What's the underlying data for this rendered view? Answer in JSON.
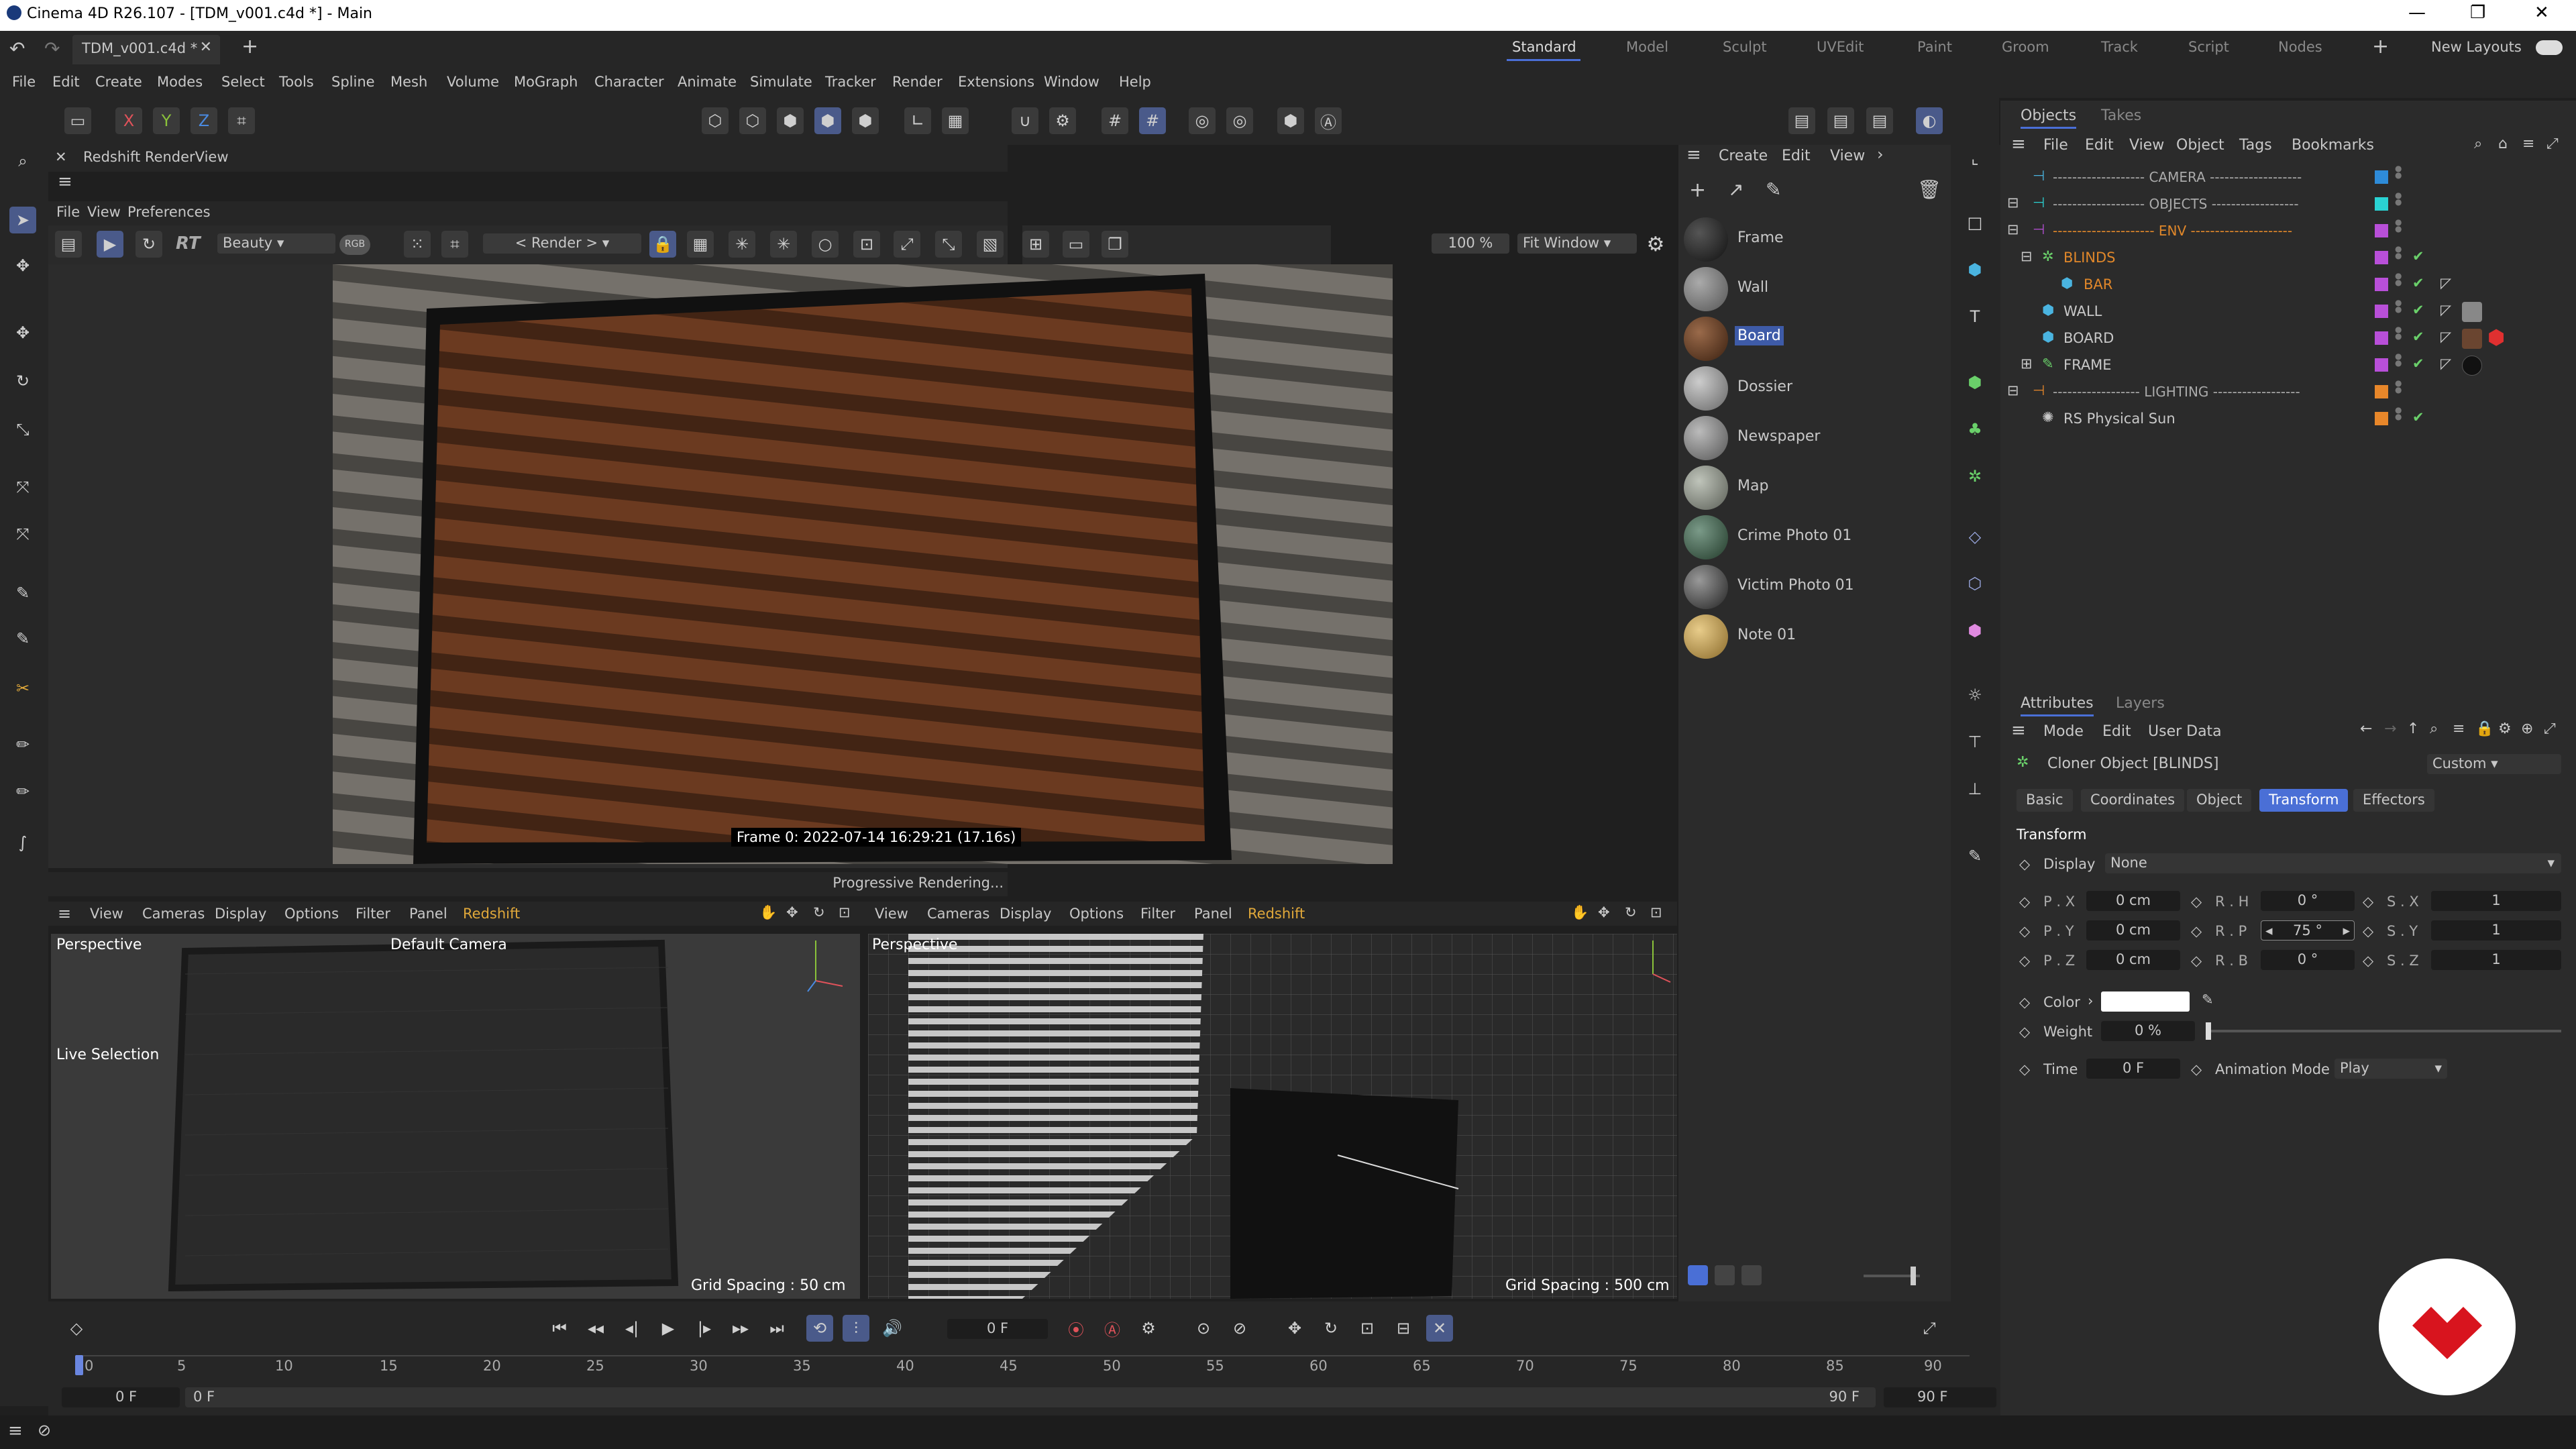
{
  "title_bar": {
    "title": "Cinema 4D R26.107 - [TDM_v001.c4d *] - Main"
  },
  "doc_tab": {
    "label": "TDM_v001.c4d *"
  },
  "layouts": {
    "items": [
      "Standard",
      "Model",
      "Sculpt",
      "UVEdit",
      "Paint",
      "Groom",
      "Track",
      "Script",
      "Nodes"
    ],
    "active": "Standard",
    "new_layouts": "New Layouts"
  },
  "menu": [
    "File",
    "Edit",
    "Create",
    "Modes",
    "Select",
    "Tools",
    "Spline",
    "Mesh",
    "Volume",
    "MoGraph",
    "Character",
    "Animate",
    "Simulate",
    "Tracker",
    "Render",
    "Extensions",
    "Window",
    "Help"
  ],
  "axes": {
    "x": "X",
    "y": "Y",
    "z": "Z"
  },
  "renderview": {
    "title": "Redshift RenderView",
    "menu": [
      "File",
      "View",
      "Preferences"
    ],
    "rt": "RT",
    "aov": "Beauty",
    "rgb": "RGB",
    "render_sel": "< Render >",
    "zoom": "100 %",
    "fit": "Fit Window",
    "frame_info": "Frame  0:  2022-07-14  16:29:21  (17.16s)",
    "status": "Progressive Rendering..."
  },
  "viewport_left": {
    "menu": [
      "View",
      "Cameras",
      "Display",
      "Options",
      "Filter",
      "Panel",
      "Redshift"
    ],
    "label": "Perspective",
    "camera": "Default Camera",
    "tool": "Live Selection",
    "grid": "Grid Spacing : 50 cm"
  },
  "viewport_right": {
    "menu": [
      "View",
      "Cameras",
      "Display",
      "Options",
      "Filter",
      "Panel",
      "Redshift"
    ],
    "label": "Perspective",
    "grid": "Grid Spacing : 500 cm"
  },
  "materials": {
    "menu": [
      "Create",
      "Edit",
      "View"
    ],
    "items": [
      {
        "name": "Frame",
        "color": "#1e1e1e"
      },
      {
        "name": "Wall",
        "color": "#7a7a7a"
      },
      {
        "name": "Board",
        "color": "#6a4530"
      },
      {
        "name": "Dossier",
        "color": "#9a9a9a"
      },
      {
        "name": "Newspaper",
        "color": "#8e8e8e"
      },
      {
        "name": "Map",
        "color": "#8f948c"
      },
      {
        "name": "Crime Photo 01",
        "color": "#4a6a58"
      },
      {
        "name": "Victim Photo 01",
        "color": "#555555"
      },
      {
        "name": "Note 01",
        "color": "#c9a45a"
      }
    ],
    "selected": "Board"
  },
  "objects": {
    "tabs": [
      "Objects",
      "Takes"
    ],
    "menu": [
      "File",
      "Edit",
      "View",
      "Object",
      "Tags",
      "Bookmarks"
    ],
    "rows": [
      {
        "name": "------------------- CAMERA -------------------",
        "color": "#2e8bd8",
        "indent": 0,
        "check": false
      },
      {
        "name": "------------------- OBJECTS ------------------",
        "color": "#2ad3d3",
        "indent": 0,
        "check": false
      },
      {
        "name": "--------------------- ENV ---------------------",
        "color": "#b84fd8",
        "indent": 0,
        "check": false,
        "orange": true
      },
      {
        "name": "BLINDS",
        "color": "#b84fd8",
        "indent": 1,
        "check": true,
        "orange": true
      },
      {
        "name": "BAR",
        "color": "#b84fd8",
        "indent": 2,
        "check": true,
        "orange": true
      },
      {
        "name": "WALL",
        "color": "#b84fd8",
        "indent": 1,
        "check": true
      },
      {
        "name": "BOARD",
        "color": "#b84fd8",
        "indent": 1,
        "check": true
      },
      {
        "name": "FRAME",
        "color": "#b84fd8",
        "indent": 1,
        "check": true
      },
      {
        "name": "------------------ LIGHTING ------------------",
        "color": "#e8872a",
        "indent": 0,
        "check": false
      },
      {
        "name": "RS Physical Sun",
        "color": "#e8872a",
        "indent": 1,
        "check": true
      }
    ]
  },
  "attributes": {
    "tabs": [
      "Attributes",
      "Layers"
    ],
    "menu": [
      "Mode",
      "Edit",
      "User Data"
    ],
    "object": "Cloner Object [BLINDS]",
    "preset": "Custom",
    "subtabs": [
      "Basic",
      "Coordinates",
      "Object",
      "Transform",
      "Effectors"
    ],
    "active_tab": "Transform",
    "section": "Transform",
    "display_label": "Display",
    "display_value": "None",
    "px": "0 cm",
    "py": "0 cm",
    "pz": "0 cm",
    "rh": "0 °",
    "rp": "75 °",
    "rb": "0 °",
    "sx": "1",
    "sy": "1",
    "sz": "1",
    "color_label": "Color",
    "weight_label": "Weight",
    "weight": "0 %",
    "time_label": "Time",
    "time": "0 F",
    "anim_label": "Animation Mode",
    "anim": "Play",
    "labels": {
      "px": "P . X",
      "py": "P . Y",
      "pz": "P . Z",
      "rh": "R . H",
      "rp": "R . P",
      "rb": "R . B",
      "sx": "S . X",
      "sy": "S . Y",
      "sz": "S . Z"
    }
  },
  "timeline": {
    "current": "0 F",
    "ticks": [
      "0",
      "5",
      "10",
      "15",
      "20",
      "25",
      "30",
      "35",
      "40",
      "45",
      "50",
      "55",
      "60",
      "65",
      "70",
      "75",
      "80",
      "85",
      "90"
    ],
    "start": "0 F",
    "start2": "0 F",
    "end": "90 F",
    "end2": "90 F"
  }
}
